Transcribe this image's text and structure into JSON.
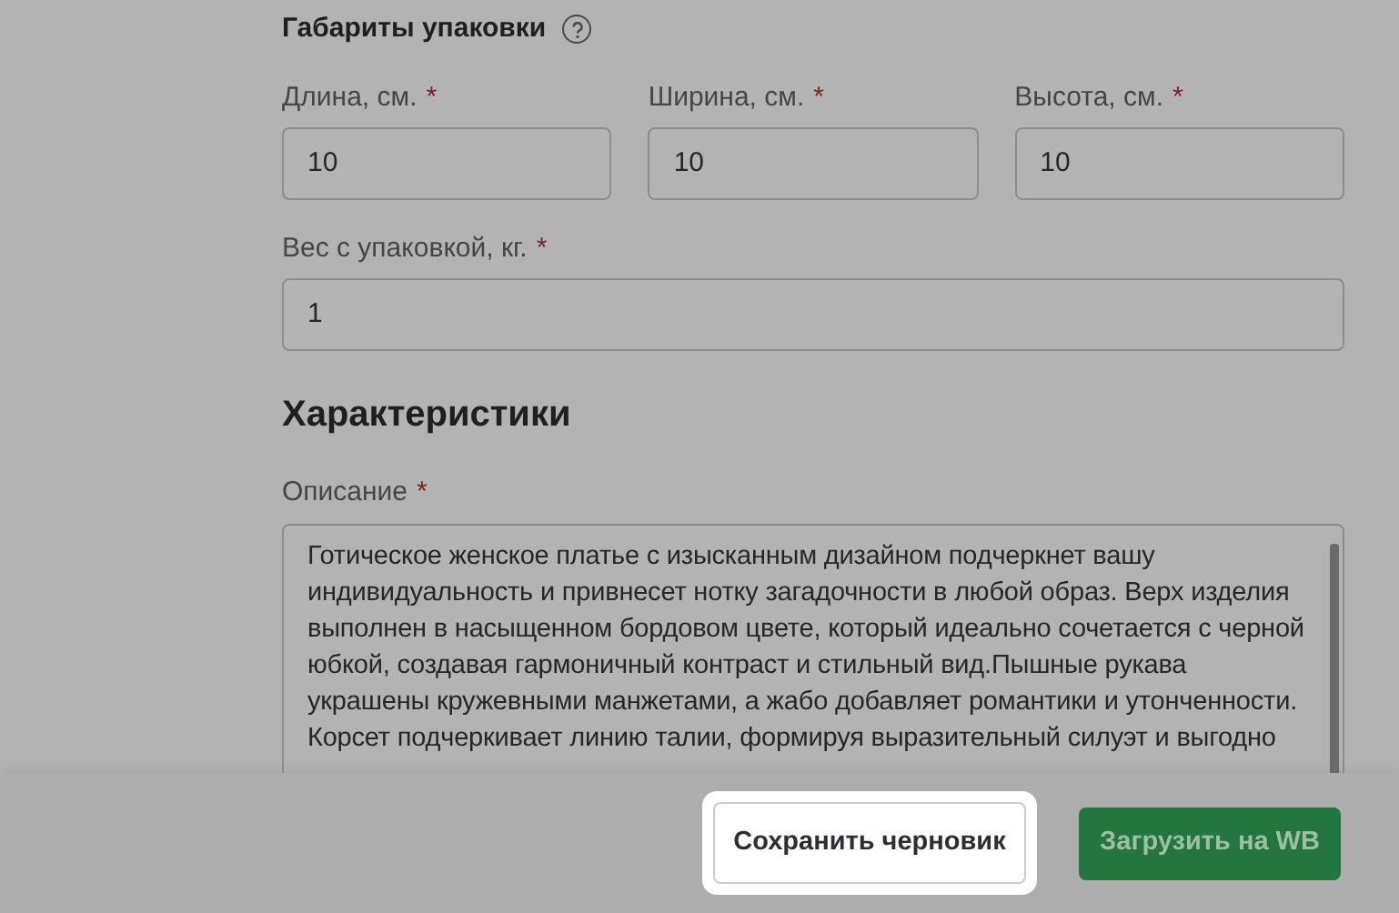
{
  "dimensions": {
    "title": "Габариты упаковки",
    "fields": [
      {
        "label": "Длина, см.",
        "required_mark": "*",
        "value": "10"
      },
      {
        "label": "Ширина, см.",
        "required_mark": "*",
        "value": "10"
      },
      {
        "label": "Высота, см.",
        "required_mark": "*",
        "value": "10"
      }
    ],
    "weight": {
      "label": "Вес с упаковкой, кг.",
      "required_mark": "*",
      "value": "1"
    }
  },
  "characteristics": {
    "title": "Характеристики",
    "description": {
      "label": "Описание",
      "required_mark": "*",
      "lines": [
        "Готическое женское платье с изысканным дизайном подчеркнет вашу",
        "индивидуальность и привнесет нотку загадочности в любой образ. Верх изделия",
        "выполнен в насыщенном бордовом цвете, который идеально сочетается с черной",
        "юбкой, создавая гармоничный контраст и стильный вид.Пышные рукава",
        "украшены кружевными манжетами, а жабо добавляет романтики и утонченности.",
        "Корсет подчеркивает линию талии, формируя выразительный силуэт и выгодно"
      ]
    }
  },
  "footer": {
    "buttons": [
      {
        "label": "Сохранить черновик",
        "kind": "secondary",
        "highlighted": true
      },
      {
        "label": "Загрузить на WB",
        "kind": "primary",
        "highlighted": false
      }
    ]
  }
}
